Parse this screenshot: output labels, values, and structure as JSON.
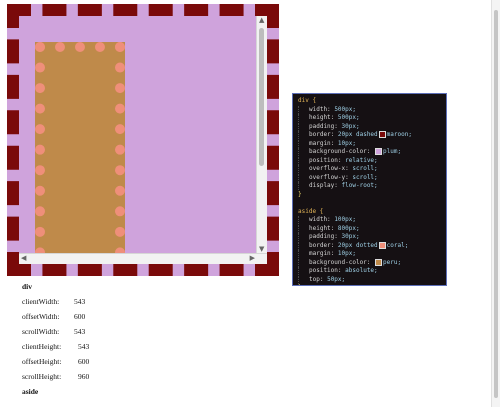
{
  "colors": {
    "div_background": "#cfa3dc",
    "div_border": "#7a0a0a",
    "aside_background": "#bf8a4a",
    "aside_border": "#ef8f7a",
    "code_background": "#151013"
  },
  "code": {
    "div": {
      "selector": "div {",
      "lines": [
        {
          "prop": "width:",
          "val": "500px;"
        },
        {
          "prop": "height:",
          "val": "500px;"
        },
        {
          "prop": "padding:",
          "val": "30px;"
        },
        {
          "prop": "border:",
          "pre": "20px dashed",
          "swatch": "#7a0a0a",
          "val": "maroon;"
        },
        {
          "prop": "margin:",
          "val": "10px;"
        },
        {
          "prop": "background-color:",
          "swatch": "#cfa3dc",
          "val": "plum;"
        },
        {
          "prop": "position:",
          "val": "relative;"
        },
        {
          "prop": "overflow-x:",
          "val": "scroll;"
        },
        {
          "prop": "overflow-y:",
          "val": "scroll;"
        },
        {
          "prop": "display:",
          "val": "flow-root;"
        }
      ],
      "close": "}"
    },
    "aside": {
      "selector": "aside {",
      "lines": [
        {
          "prop": "width:",
          "val": "100px;"
        },
        {
          "prop": "height:",
          "val": "800px;"
        },
        {
          "prop": "padding:",
          "val": "30px;"
        },
        {
          "prop": "border:",
          "pre": "20px dotted",
          "swatch": "#ef8f7a",
          "val": "coral;"
        },
        {
          "prop": "margin:",
          "val": "10px;"
        },
        {
          "prop": "background-color:",
          "swatch": "#bf8a4a",
          "val": "peru;"
        },
        {
          "prop": "position:",
          "val": "absolute;"
        },
        {
          "prop": "top:",
          "val": "50px;"
        }
      ],
      "close": "}"
    }
  },
  "metrics": {
    "div_heading": "div",
    "rows": [
      {
        "label": "clientWidth:",
        "value": "543"
      },
      {
        "label": "offsetWidth:",
        "value": "600"
      },
      {
        "label": "scrollWidth:",
        "value": "543"
      },
      {
        "label": "clientHeight:",
        "value": "543"
      },
      {
        "label": "offsetHeight:",
        "value": "600"
      },
      {
        "label": "scrollHeight:",
        "value": "960"
      }
    ],
    "aside_heading": "aside"
  }
}
